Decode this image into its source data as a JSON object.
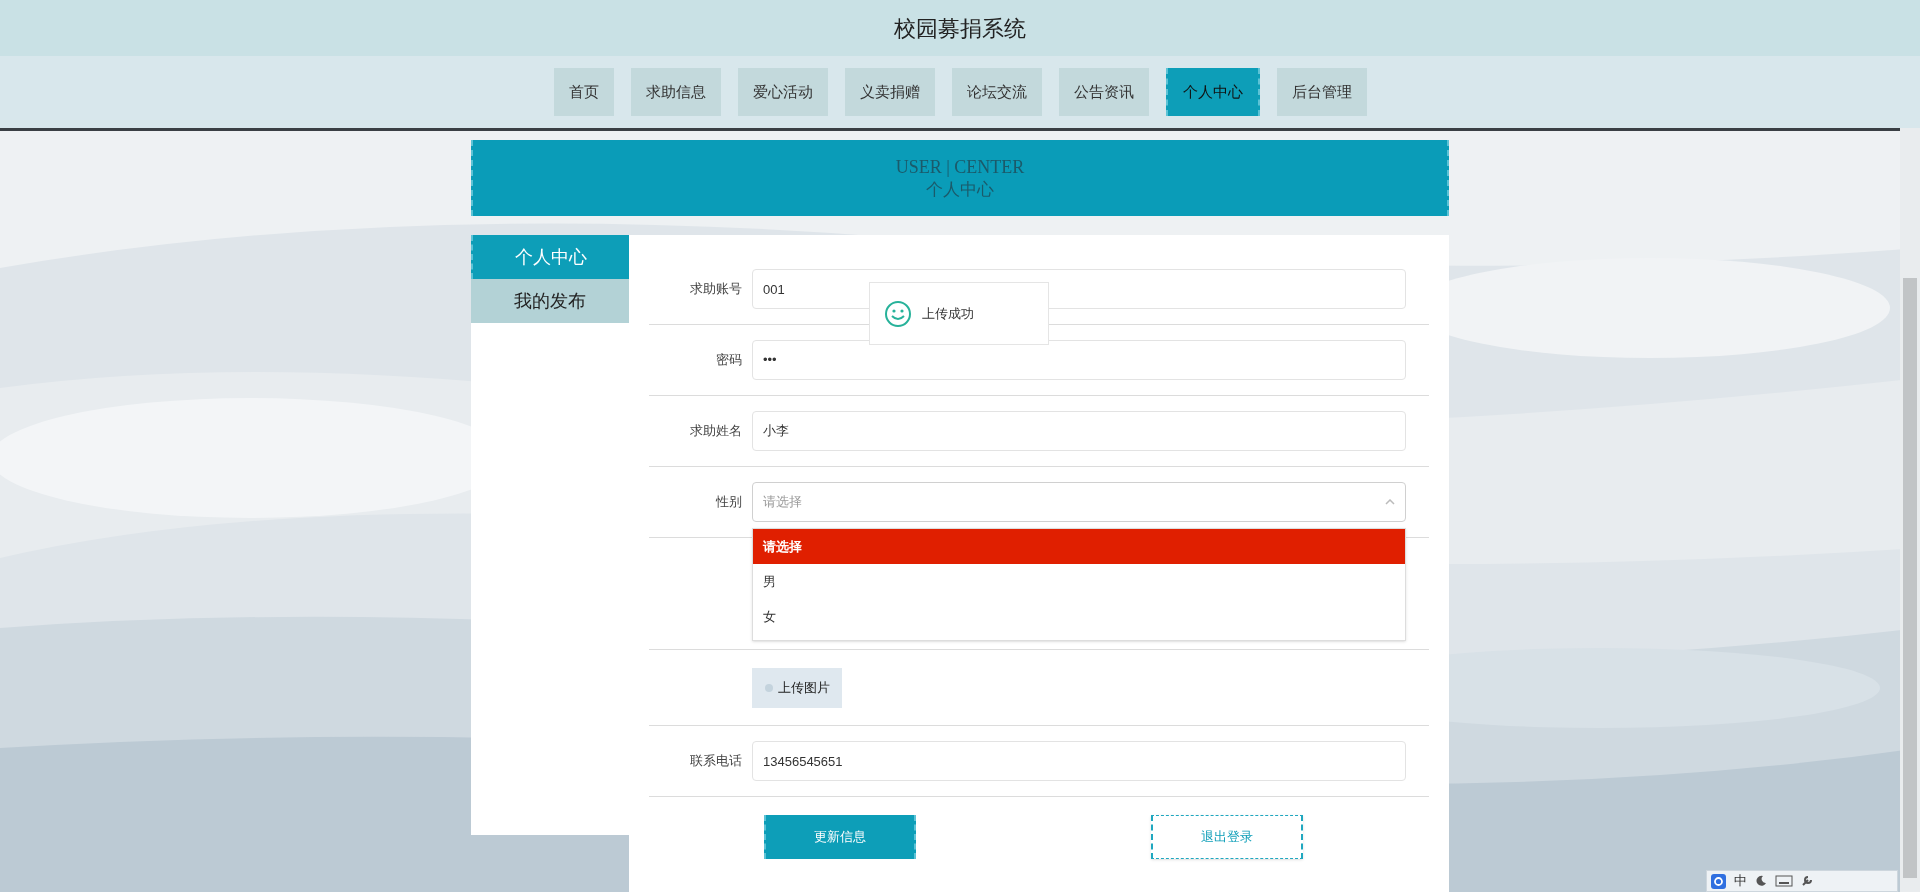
{
  "site_title": "校园募捐系统",
  "nav": [
    {
      "label": "首页",
      "selected": false
    },
    {
      "label": "求助信息",
      "selected": false
    },
    {
      "label": "爱心活动",
      "selected": false
    },
    {
      "label": "义卖捐赠",
      "selected": false
    },
    {
      "label": "论坛交流",
      "selected": false
    },
    {
      "label": "公告资讯",
      "selected": false
    },
    {
      "label": "个人中心",
      "selected": true
    },
    {
      "label": "后台管理",
      "selected": false
    }
  ],
  "banner": {
    "title_en": "USER | CENTER",
    "title_cn": "个人中心"
  },
  "sidebar": [
    {
      "label": "个人中心",
      "selected": true
    },
    {
      "label": "我的发布",
      "selected": false
    }
  ],
  "form": {
    "fields": [
      {
        "kind": "text",
        "label": "求助账号",
        "value": "001"
      },
      {
        "kind": "password",
        "label": "密码",
        "value": "•••"
      },
      {
        "kind": "text",
        "label": "求助姓名",
        "value": "小李"
      },
      {
        "kind": "select",
        "label": "性别",
        "placeholder": "请选择",
        "expanded": true,
        "options": [
          {
            "label": "请选择",
            "selected": true
          },
          {
            "label": "男",
            "selected": false
          },
          {
            "label": "女",
            "selected": false
          }
        ]
      },
      {
        "kind": "blank"
      },
      {
        "kind": "upload",
        "button": "上传图片"
      },
      {
        "kind": "text",
        "label": "联系电话",
        "value": "13456545651"
      }
    ],
    "buttons": [
      {
        "kind": "primary",
        "label": "更新信息"
      },
      {
        "kind": "outline",
        "label": "退出登录"
      }
    ]
  },
  "toast": {
    "message": "上传成功"
  },
  "ime": {
    "mode": "中"
  }
}
